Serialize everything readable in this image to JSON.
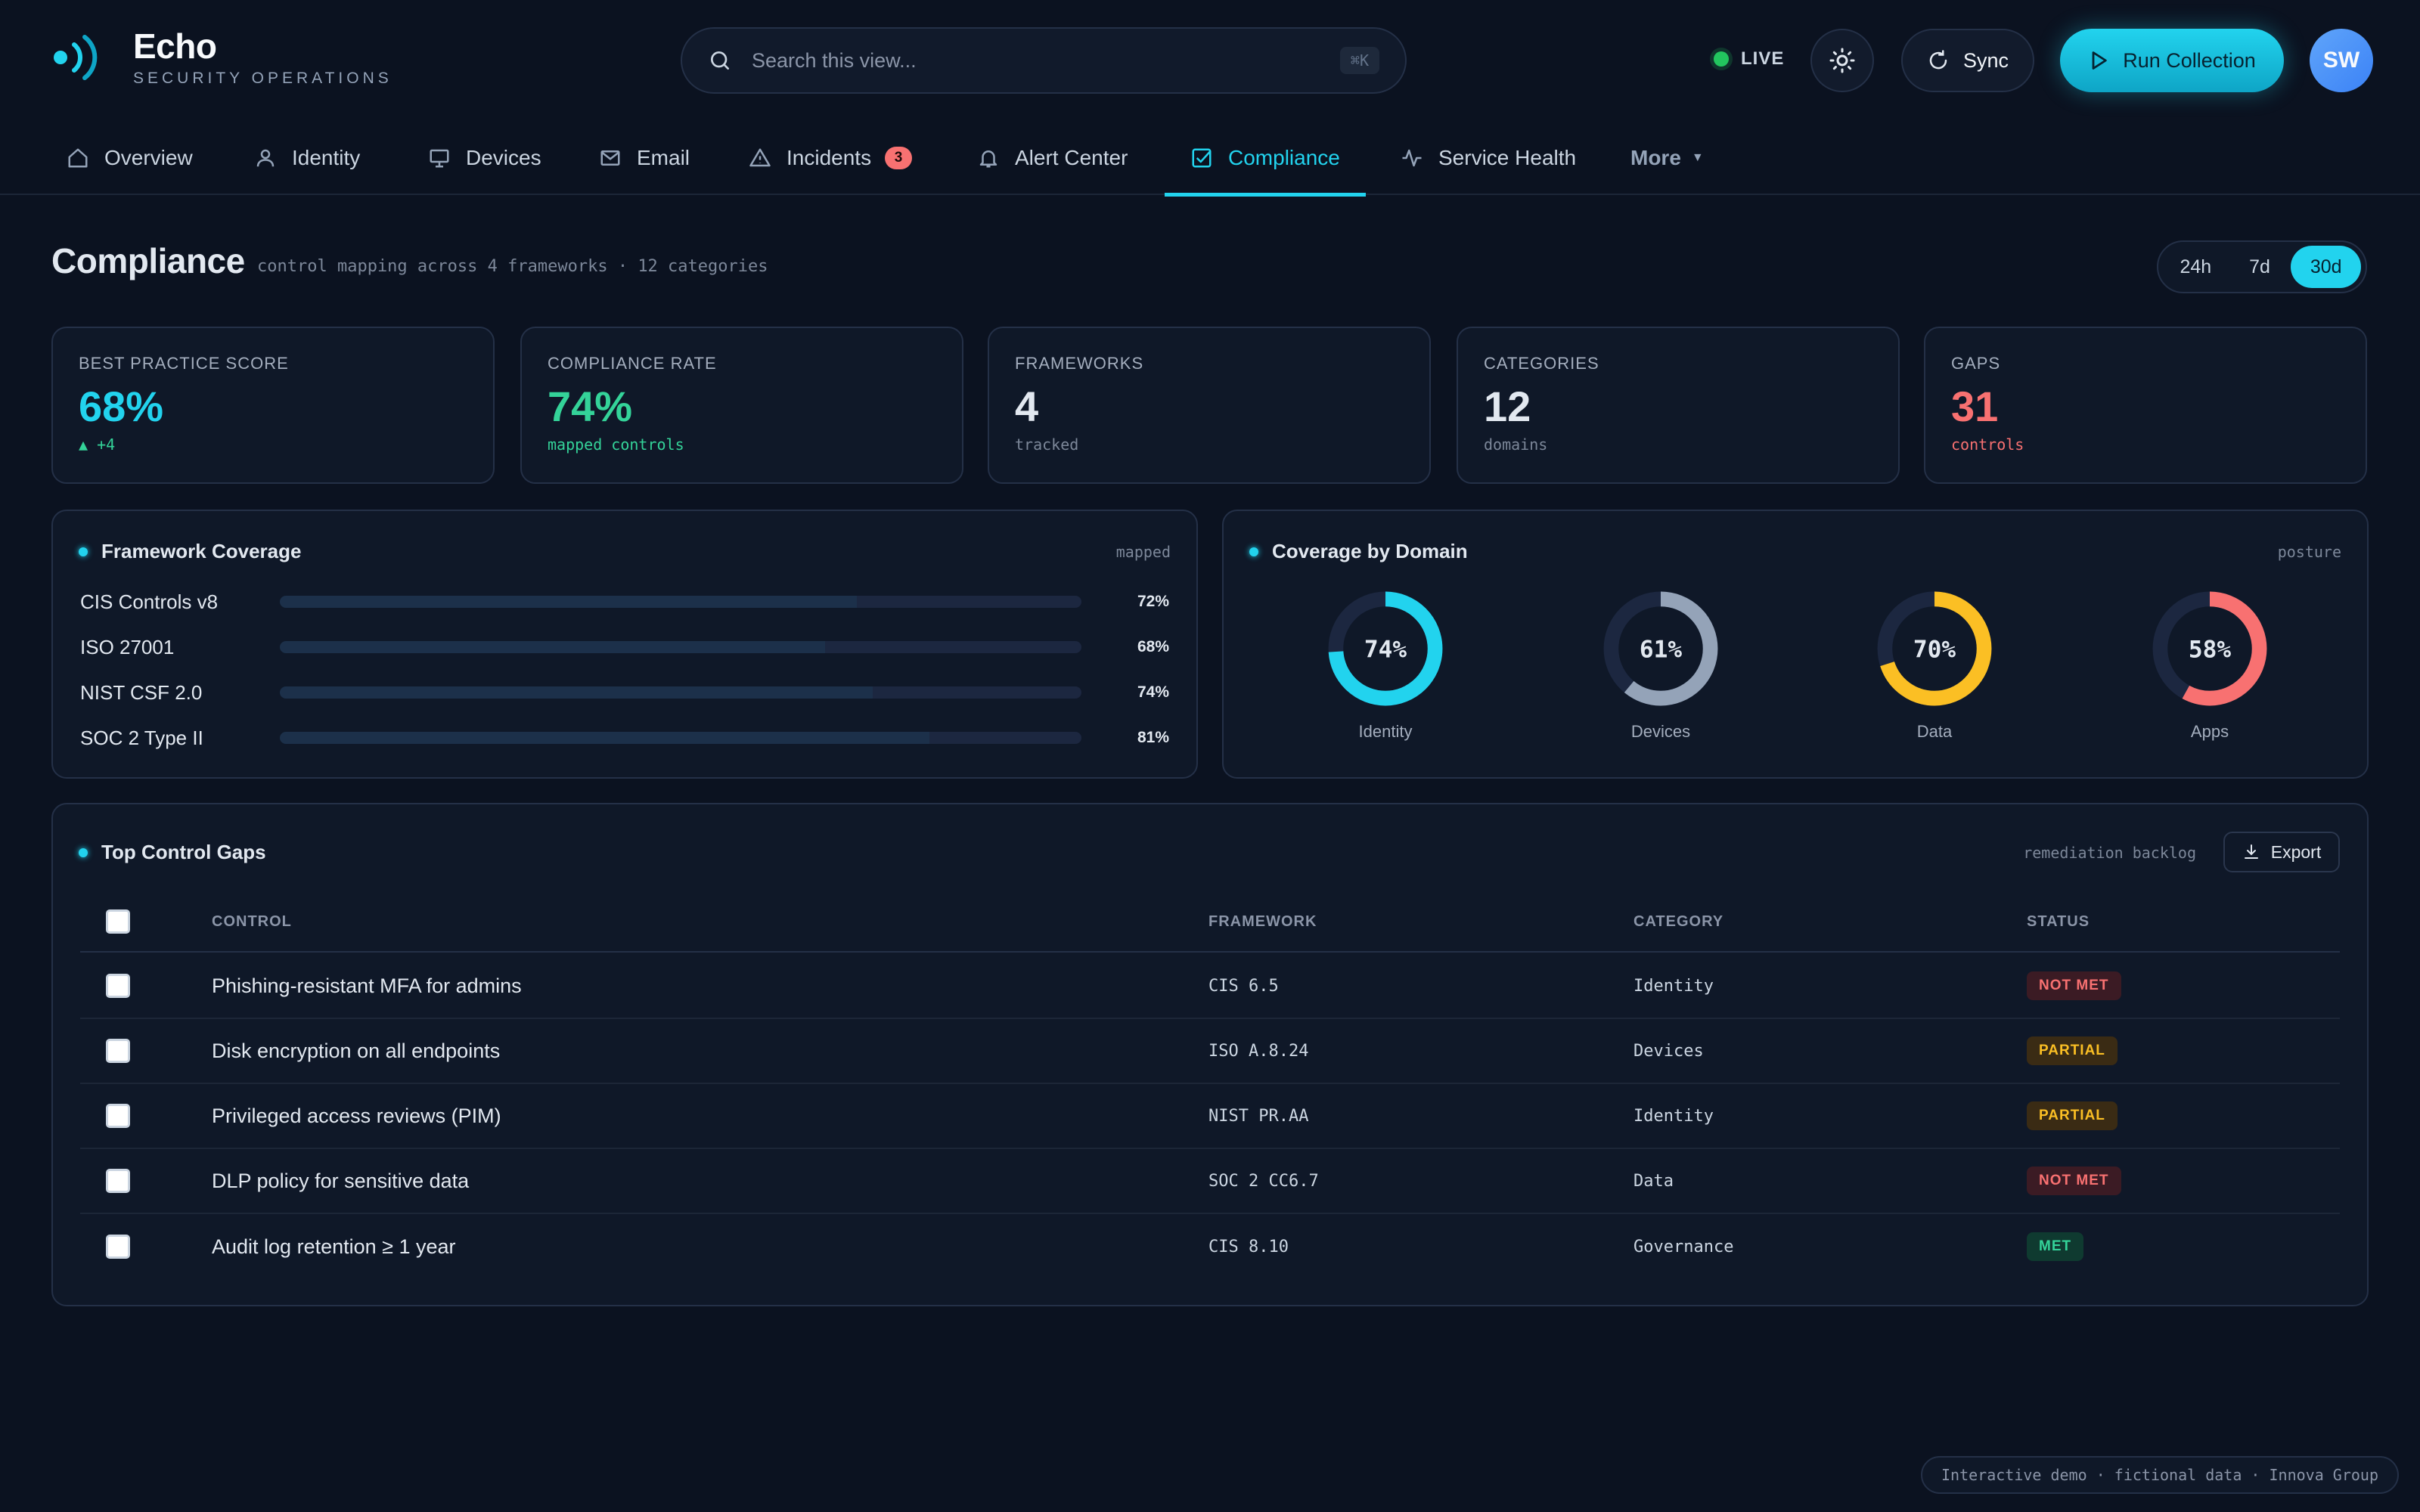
{
  "brand": {
    "name": "Echo",
    "subtitle": "SECURITY OPERATIONS"
  },
  "search": {
    "placeholder": "Search this view...",
    "shortcut": "⌘K"
  },
  "header": {
    "live_label": "LIVE",
    "theme_icon": "sun-icon",
    "sync_label": "Sync",
    "run_label": "Run Collection",
    "avatar_initials": "SW"
  },
  "nav": {
    "items": [
      {
        "label": "Overview",
        "icon": "home-icon"
      },
      {
        "label": "Identity",
        "icon": "user-icon"
      },
      {
        "label": "Devices",
        "icon": "monitor-icon"
      },
      {
        "label": "Email",
        "icon": "mail-icon"
      },
      {
        "label": "Incidents",
        "icon": "alert-triangle-icon",
        "badge": "3"
      },
      {
        "label": "Alert Center",
        "icon": "bell-icon"
      },
      {
        "label": "Compliance",
        "icon": "checkbox-icon",
        "active": true
      },
      {
        "label": "Service Health",
        "icon": "activity-icon"
      }
    ],
    "more_label": "More"
  },
  "page": {
    "title": "Compliance",
    "subtitle": "control mapping across 4 frameworks · 12 categories",
    "ranges": [
      "24h",
      "7d",
      "30d"
    ],
    "selected_range": "30d"
  },
  "kpis": [
    {
      "label": "BEST PRACTICE SCORE",
      "value": "68%",
      "sub": "▲ +4",
      "tone": "cyan"
    },
    {
      "label": "COMPLIANCE RATE",
      "value": "74%",
      "sub": "mapped controls",
      "tone": "green"
    },
    {
      "label": "FRAMEWORKS",
      "value": "4",
      "sub": "tracked",
      "tone": "neutral"
    },
    {
      "label": "CATEGORIES",
      "value": "12",
      "sub": "domains",
      "tone": "neutral"
    },
    {
      "label": "GAPS",
      "value": "31",
      "sub": "controls",
      "tone": "red"
    }
  ],
  "framework_panel": {
    "title": "Framework Coverage",
    "tag": "mapped",
    "rows": [
      {
        "name": "CIS Controls v8",
        "percent": 72,
        "label": "72%"
      },
      {
        "name": "ISO 27001",
        "percent": 68,
        "label": "68%"
      },
      {
        "name": "NIST CSF 2.0",
        "percent": 74,
        "label": "74%"
      },
      {
        "name": "SOC 2 Type II",
        "percent": 81,
        "label": "81%"
      }
    ]
  },
  "domain_panel": {
    "title": "Coverage by Domain",
    "tag": "posture",
    "donuts": [
      {
        "name": "Identity",
        "percent": 74,
        "label": "74%",
        "color": "#22d3ee"
      },
      {
        "name": "Devices",
        "percent": 61,
        "label": "61%",
        "color": "#94a3b8"
      },
      {
        "name": "Data",
        "percent": 70,
        "label": "70%",
        "color": "#fbbf24"
      },
      {
        "name": "Apps",
        "percent": 58,
        "label": "58%",
        "color": "#f87171"
      }
    ]
  },
  "gaps_panel": {
    "title": "Top Control Gaps",
    "tag": "remediation backlog",
    "export_label": "Export",
    "columns": [
      "CONTROL",
      "FRAMEWORK",
      "CATEGORY",
      "STATUS"
    ],
    "rows": [
      {
        "control": "Phishing-resistant MFA for admins",
        "framework": "CIS 6.5",
        "category": "Identity",
        "status": "NOT MET",
        "status_kind": "notmet"
      },
      {
        "control": "Disk encryption on all endpoints",
        "framework": "ISO A.8.24",
        "category": "Devices",
        "status": "PARTIAL",
        "status_kind": "partial"
      },
      {
        "control": "Privileged access reviews (PIM)",
        "framework": "NIST PR.AA",
        "category": "Identity",
        "status": "PARTIAL",
        "status_kind": "partial"
      },
      {
        "control": "DLP policy for sensitive data",
        "framework": "SOC 2 CC6.7",
        "category": "Data",
        "status": "NOT MET",
        "status_kind": "notmet"
      },
      {
        "control": "Audit log retention ≥ 1 year",
        "framework": "CIS 8.10",
        "category": "Governance",
        "status": "MET",
        "status_kind": "met"
      }
    ]
  },
  "footer": {
    "text": "Interactive demo · fictional data · Innova Group"
  },
  "colors": {
    "accent": "#22d3ee",
    "green": "#34d399",
    "red": "#f87171",
    "amber": "#fbbf24",
    "bg": "#0b1220"
  }
}
